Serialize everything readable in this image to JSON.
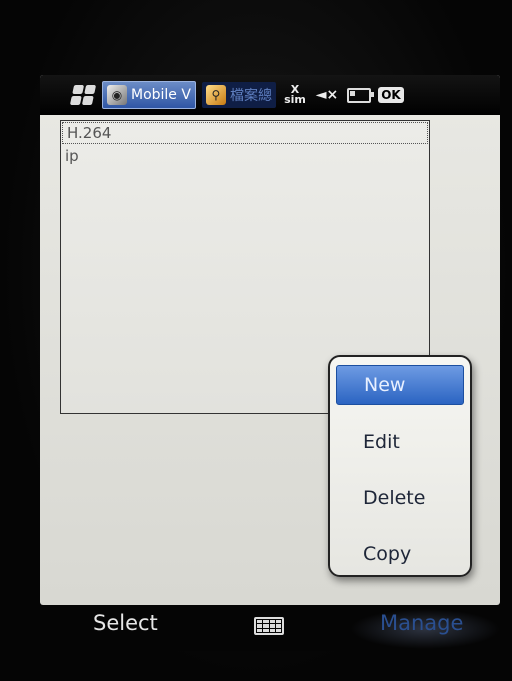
{
  "statusbar": {
    "start_icon": "windows-flag-icon",
    "tasks": [
      {
        "label": "Mobile V",
        "icon": "camera-app-icon",
        "active": true
      },
      {
        "label": "檔案總",
        "icon": "search-app-icon",
        "active": false
      }
    ],
    "indicators": [
      "no-sim-icon",
      "volume-mute-icon",
      "battery-icon"
    ],
    "sim_text": "X sim",
    "mute_text": "◄×",
    "ok_label": "OK"
  },
  "list": {
    "items": [
      {
        "label": "H.264",
        "selected": true
      },
      {
        "label": "ip",
        "selected": false
      }
    ]
  },
  "context_menu": {
    "items": [
      {
        "label": "New",
        "highlighted": true
      },
      {
        "label": "Edit",
        "highlighted": false
      },
      {
        "label": "Delete",
        "highlighted": false
      },
      {
        "label": "Copy",
        "highlighted": false
      }
    ]
  },
  "softkeys": {
    "left": "Select",
    "middle_icon": "keyboard-icon",
    "right": "Manage"
  },
  "colors": {
    "highlight": "#2b64c2",
    "active_task": "#2f56a5"
  }
}
